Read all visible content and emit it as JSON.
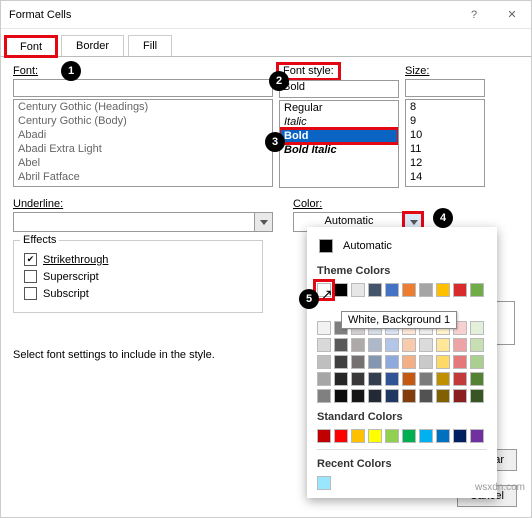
{
  "title": "Format Cells",
  "tabs": [
    "Font",
    "Border",
    "Fill"
  ],
  "labels": {
    "font": "Font:",
    "fontstyle": "Font style:",
    "size": "Size:",
    "underline": "Underline:",
    "color": "Color:"
  },
  "font_value": "",
  "font_list": [
    "Century Gothic (Headings)",
    "Century Gothic (Body)",
    "Abadi",
    "Abadi Extra Light",
    "Abel",
    "Abril Fatface"
  ],
  "style_value": "Bold",
  "style_list": [
    "Regular",
    "Italic",
    "Bold",
    "Bold Italic"
  ],
  "size_value": "",
  "size_list": [
    "8",
    "9",
    "10",
    "11",
    "12",
    "14"
  ],
  "color_value": "Automatic",
  "effects": {
    "legend": "Effects",
    "strike": "Strikethrough",
    "sup": "Superscript",
    "sub": "Subscript"
  },
  "styletext": "Select font settings to include in the style.",
  "dropdown": {
    "automatic": "Automatic",
    "theme": "Theme Colors",
    "tooltip": "White, Background 1",
    "standard": "Standard Colors",
    "recent": "Recent Colors"
  },
  "theme_row1": [
    "#ffffff",
    "#000000",
    "#e7e6e6",
    "#44546a",
    "#4472c4",
    "#ed7d31",
    "#a5a5a5",
    "#ffc000",
    "#d92b2b",
    "#70ad47"
  ],
  "theme_shades": [
    [
      "#f2f2f2",
      "#7f7f7f",
      "#d0cece",
      "#d6dce5",
      "#d9e1f2",
      "#fce4d6",
      "#ededed",
      "#fff2cc",
      "#f7d1d1",
      "#e2efda"
    ],
    [
      "#d9d9d9",
      "#595959",
      "#aeaaaa",
      "#adb9ca",
      "#b4c6e7",
      "#f8cbad",
      "#dbdbdb",
      "#ffe699",
      "#eea4a4",
      "#c6e0b4"
    ],
    [
      "#bfbfbf",
      "#404040",
      "#757171",
      "#8497b0",
      "#8ea9db",
      "#f4b084",
      "#c9c9c9",
      "#ffd966",
      "#e57878",
      "#a9d08e"
    ],
    [
      "#a6a6a6",
      "#262626",
      "#3a3838",
      "#333f4f",
      "#305496",
      "#c65911",
      "#7b7b7b",
      "#bf8f00",
      "#c23a3a",
      "#548235"
    ],
    [
      "#808080",
      "#0d0d0d",
      "#161616",
      "#222b35",
      "#203764",
      "#833c0c",
      "#525252",
      "#806000",
      "#8b1f1f",
      "#375623"
    ]
  ],
  "standard_row": [
    "#c00000",
    "#ff0000",
    "#ffc000",
    "#ffff00",
    "#92d050",
    "#00b050",
    "#00b0f0",
    "#0070c0",
    "#002060",
    "#7030a0"
  ],
  "recent": [
    "#99e6ff"
  ],
  "buttons": {
    "clear": "Clear",
    "cancel": "Cancel"
  },
  "watermark": "wsxdn.com"
}
